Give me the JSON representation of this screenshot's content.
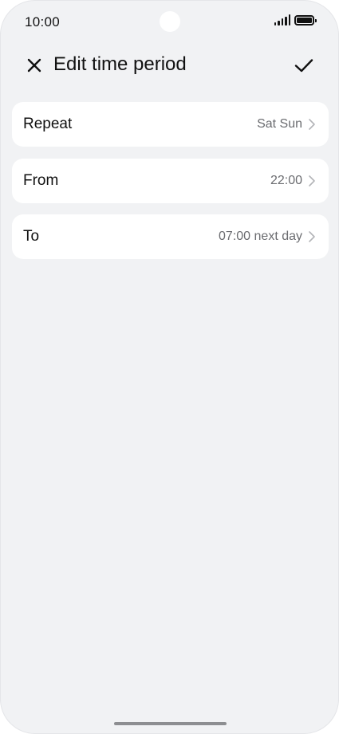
{
  "status_bar": {
    "time": "10:00",
    "icons": [
      "signal-icon",
      "battery-icon"
    ]
  },
  "header": {
    "title": "Edit time period",
    "close_icon": "close-icon",
    "confirm_icon": "check-icon"
  },
  "settings": [
    {
      "label": "Repeat",
      "value": "Sat Sun"
    },
    {
      "label": "From",
      "value": "22:00"
    },
    {
      "label": "To",
      "value": "07:00 next day"
    }
  ],
  "colors": {
    "background": "#f1f2f4",
    "card": "#ffffff",
    "text": "#111111",
    "secondary_text": "#6b6c70"
  }
}
